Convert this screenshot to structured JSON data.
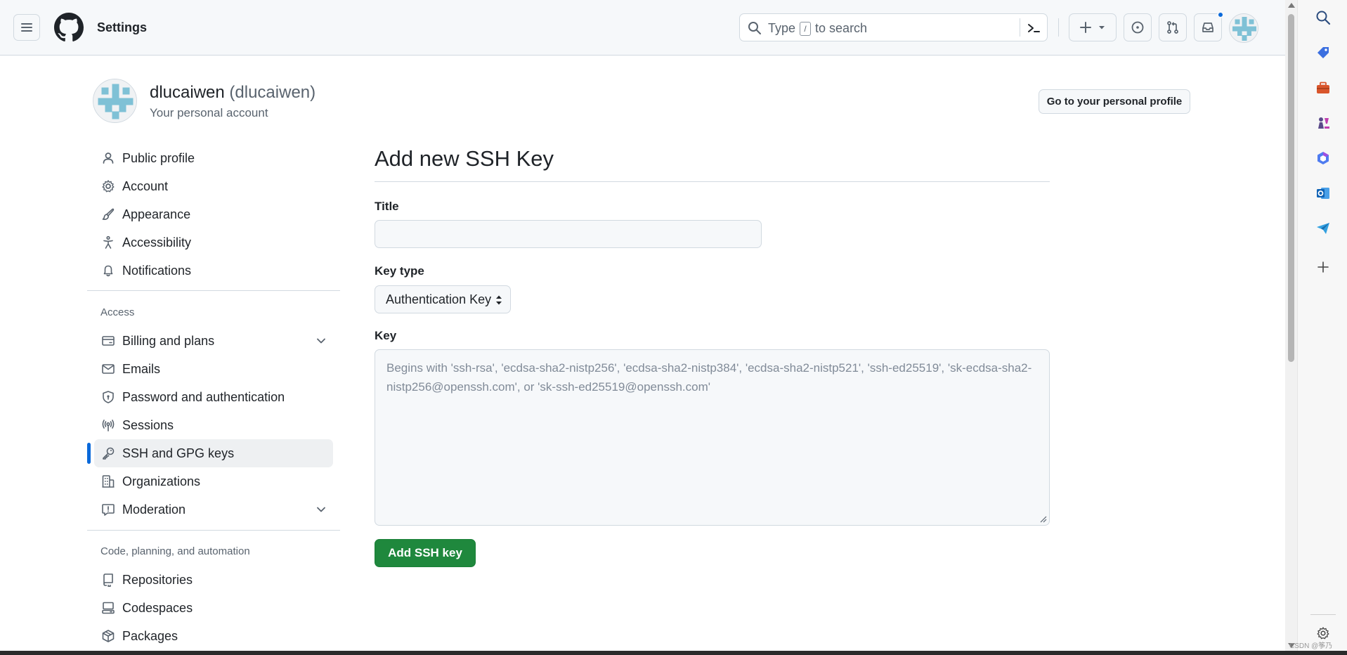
{
  "header": {
    "title": "Settings",
    "search_prefix": "Type",
    "search_key": "/",
    "search_suffix": "to search"
  },
  "account": {
    "name": "dlucaiwen",
    "login": "(dlucaiwen)",
    "subtitle": "Your personal account",
    "profile_button": "Go to your personal profile"
  },
  "nav": {
    "group1": [
      {
        "label": "Public profile",
        "icon": "person-icon"
      },
      {
        "label": "Account",
        "icon": "gear-icon"
      },
      {
        "label": "Appearance",
        "icon": "paintbrush-icon"
      },
      {
        "label": "Accessibility",
        "icon": "accessibility-icon"
      },
      {
        "label": "Notifications",
        "icon": "bell-icon"
      }
    ],
    "access_heading": "Access",
    "group2": [
      {
        "label": "Billing and plans",
        "icon": "credit-card-icon"
      },
      {
        "label": "Emails",
        "icon": "mail-icon"
      },
      {
        "label": "Password and authentication",
        "icon": "shield-lock-icon"
      },
      {
        "label": "Sessions",
        "icon": "broadcast-icon"
      },
      {
        "label": "SSH and GPG keys",
        "icon": "key-icon"
      },
      {
        "label": "Organizations",
        "icon": "organization-icon"
      },
      {
        "label": "Moderation",
        "icon": "report-icon"
      }
    ],
    "code_heading": "Code, planning, and automation",
    "group3": [
      {
        "label": "Repositories",
        "icon": "repo-icon"
      },
      {
        "label": "Codespaces",
        "icon": "codespaces-icon"
      },
      {
        "label": "Packages",
        "icon": "package-icon"
      }
    ]
  },
  "form": {
    "heading": "Add new SSH Key",
    "title_label": "Title",
    "title_value": "",
    "key_type_label": "Key type",
    "key_type_value": "Authentication Key",
    "key_label": "Key",
    "key_placeholder": "Begins with 'ssh-rsa', 'ecdsa-sha2-nistp256', 'ecdsa-sha2-nistp384', 'ecdsa-sha2-nistp521', 'ssh-ed25519', 'sk-ecdsa-sha2-nistp256@openssh.com', or 'sk-ssh-ed25519@openssh.com'",
    "submit_label": "Add SSH key"
  },
  "watermark": "CSDN @筝乃",
  "colors": {
    "accent": "#0969da",
    "primary_button": "#1f883d",
    "header_bg": "#f6f8fa",
    "border": "#d1d9e0"
  }
}
